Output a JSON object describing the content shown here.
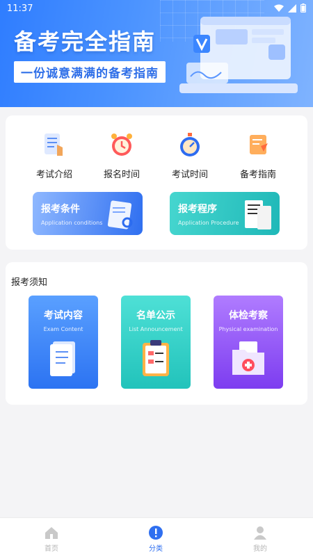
{
  "status": {
    "time": "11:37"
  },
  "banner": {
    "title": "备考完全指南",
    "subtitle": "一份诚意满满的备考指南"
  },
  "quick_links": [
    {
      "label": "考试介绍",
      "icon": "document-icon"
    },
    {
      "label": "报名时间",
      "icon": "alarm-clock-icon"
    },
    {
      "label": "考试时间",
      "icon": "stopwatch-icon"
    },
    {
      "label": "备考指南",
      "icon": "scroll-icon"
    }
  ],
  "pills": [
    {
      "title": "报考条件",
      "subtitle": "Application conditions"
    },
    {
      "title": "报考程序",
      "subtitle": "Application Procedure"
    }
  ],
  "notice": {
    "title": "报考须知",
    "tiles": [
      {
        "title": "考试内容",
        "subtitle": "Exam Content"
      },
      {
        "title": "名单公示",
        "subtitle": "List Announcement"
      },
      {
        "title": "体检考察",
        "subtitle": "Physical examination"
      }
    ]
  },
  "tabs": [
    {
      "label": "首页"
    },
    {
      "label": "分类"
    },
    {
      "label": "我的"
    }
  ],
  "colors": {
    "primary": "#2f6ff0",
    "teal": "#22c3bb",
    "purple": "#7d3df0"
  }
}
